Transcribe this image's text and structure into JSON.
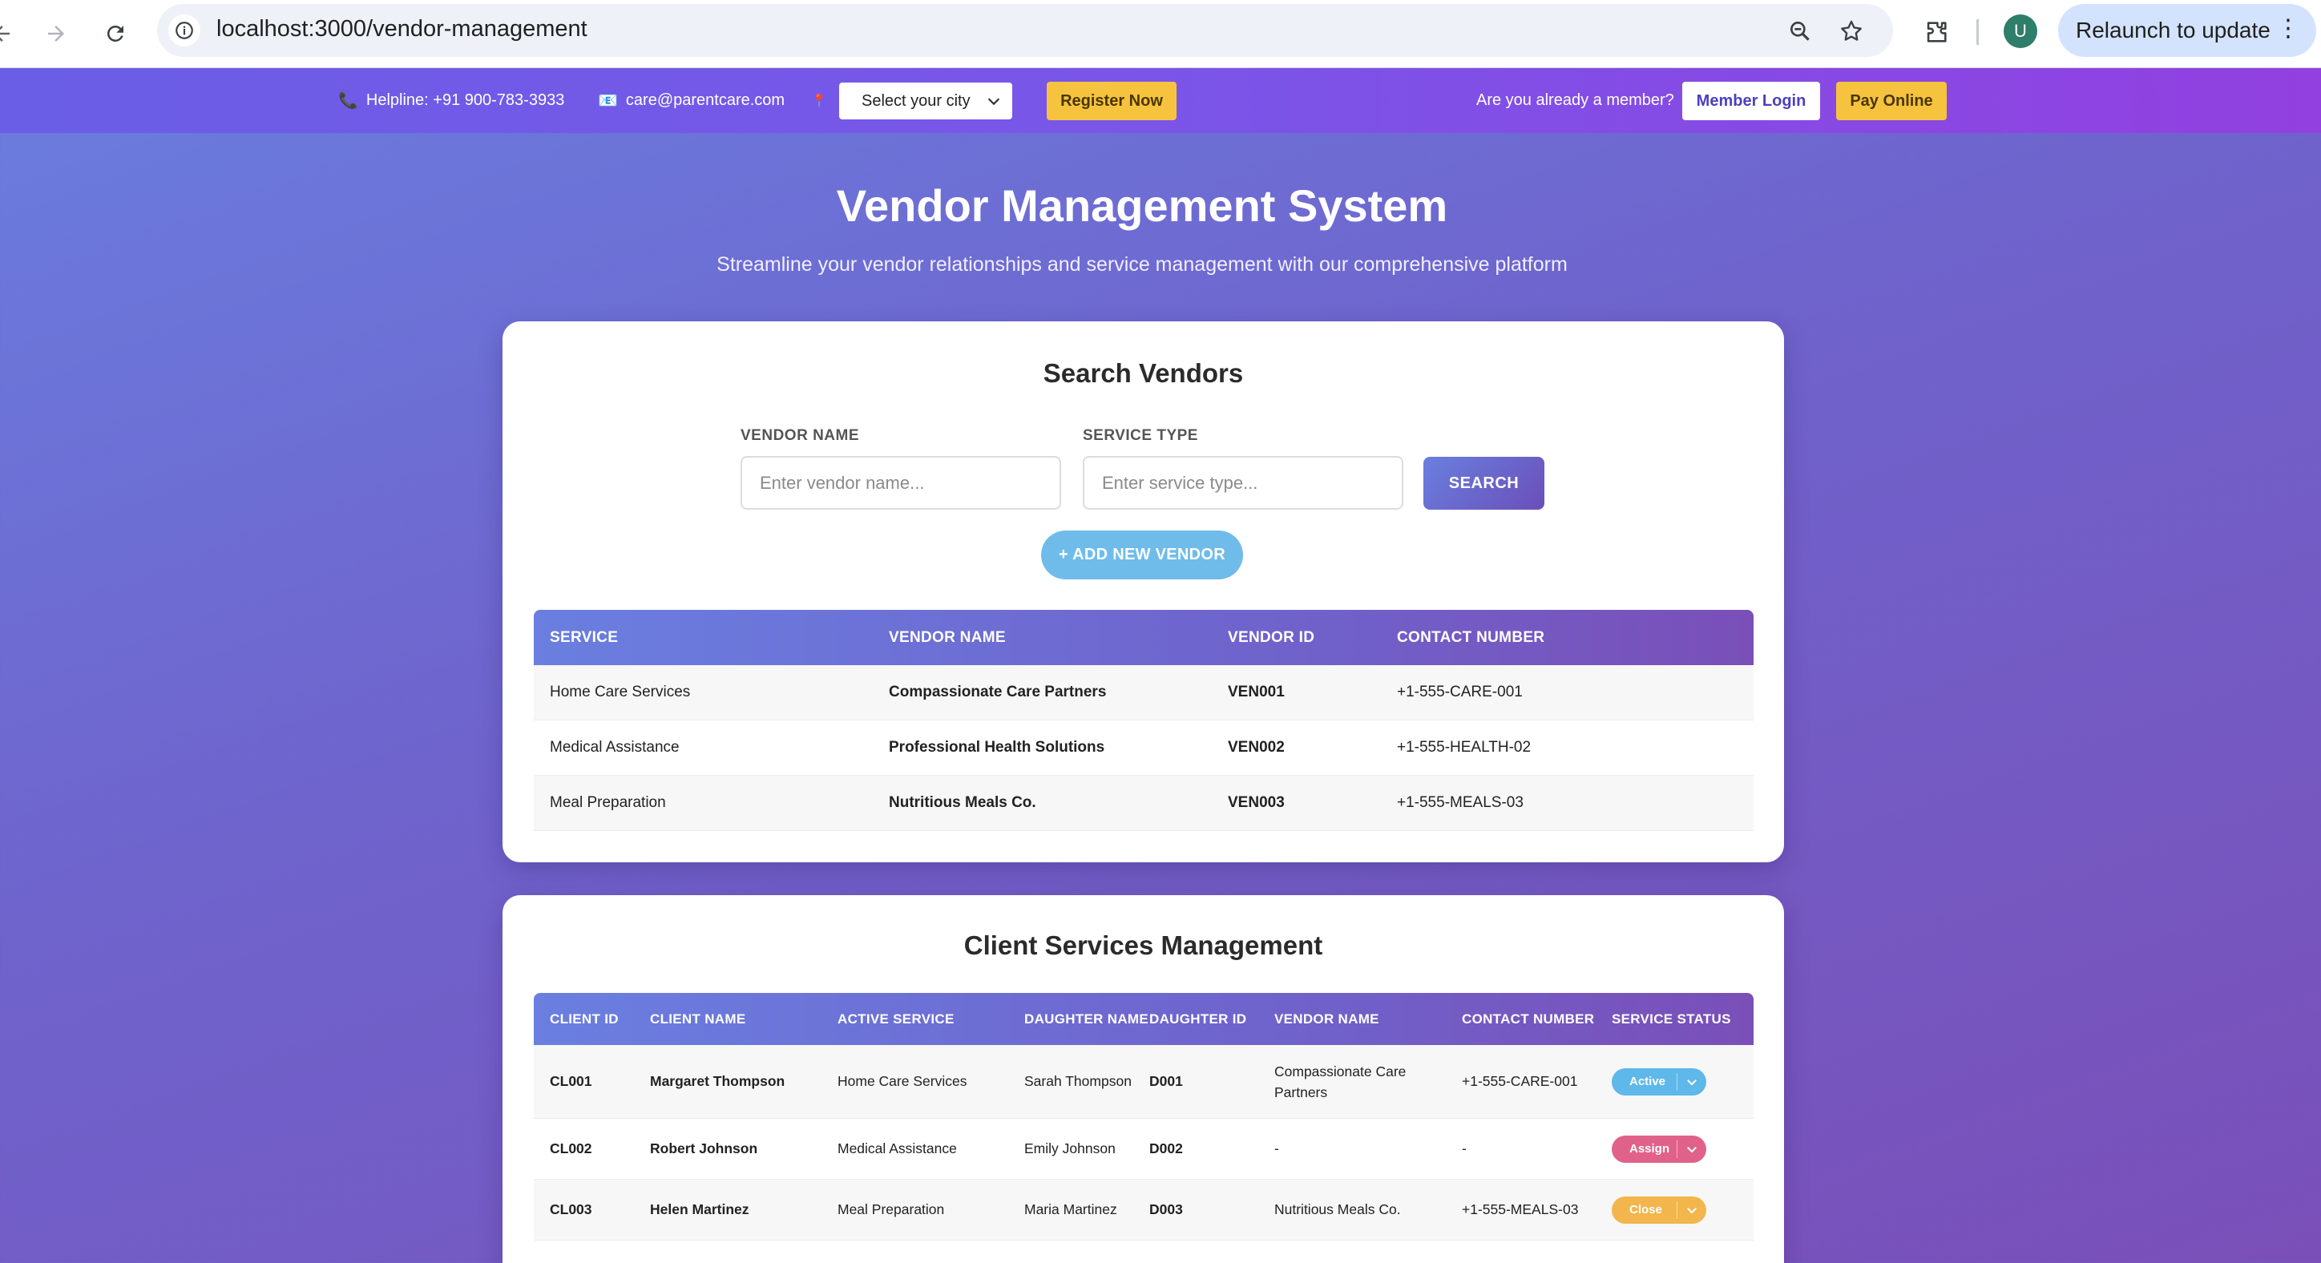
{
  "browser": {
    "url": "localhost:3000/vendor-management",
    "relaunch_label": "Relaunch to update",
    "avatar_letter": "U"
  },
  "topbar": {
    "helpline": "Helpline: +91 900-783-3933",
    "email": "care@parentcare.com",
    "city_select": "Select your city",
    "register": "Register Now",
    "member_prompt": "Are you already a member?",
    "member_login": "Member Login",
    "pay_online": "Pay Online"
  },
  "hero": {
    "title": "Vendor Management System",
    "subtitle": "Streamline your vendor relationships and service management with our comprehensive platform"
  },
  "search": {
    "title": "Search Vendors",
    "vendor_name_label": "VENDOR NAME",
    "vendor_name_placeholder": "Enter vendor name...",
    "service_type_label": "SERVICE TYPE",
    "service_type_placeholder": "Enter service type...",
    "search_button": "SEARCH",
    "add_button": "+ ADD NEW VENDOR"
  },
  "vendor_table": {
    "headers": [
      "SERVICE",
      "VENDOR NAME",
      "VENDOR ID",
      "CONTACT NUMBER"
    ],
    "rows": [
      [
        "Home Care Services",
        "Compassionate Care Partners",
        "VEN001",
        "+1-555-CARE-001"
      ],
      [
        "Medical Assistance",
        "Professional Health Solutions",
        "VEN002",
        "+1-555-HEALTH-02"
      ],
      [
        "Meal Preparation",
        "Nutritious Meals Co.",
        "VEN003",
        "+1-555-MEALS-03"
      ]
    ]
  },
  "client_section": {
    "title": "Client Services Management",
    "headers": [
      "CLIENT ID",
      "CLIENT NAME",
      "ACTIVE SERVICE",
      "DAUGHTER NAME",
      "DAUGHTER ID",
      "VENDOR NAME",
      "CONTACT NUMBER",
      "SERVICE STATUS"
    ],
    "rows": [
      [
        "CL001",
        "Margaret Thompson",
        "Home Care Services",
        "Sarah Thompson",
        "D001",
        "Compassionate Care Partners",
        "+1-555-CARE-001",
        "Active"
      ],
      [
        "CL002",
        "Robert Johnson",
        "Medical Assistance",
        "Emily Johnson",
        "D002",
        "-",
        "-",
        "Assign"
      ],
      [
        "CL003",
        "Helen Martinez",
        "Meal Preparation",
        "Maria Martinez",
        "D003",
        "Nutritious Meals Co.",
        "+1-555-MEALS-03",
        "Close"
      ]
    ],
    "status_colors": {
      "Active": "#5eb8ea",
      "Assign": "#e0628a",
      "Close": "#f2b64c"
    }
  }
}
